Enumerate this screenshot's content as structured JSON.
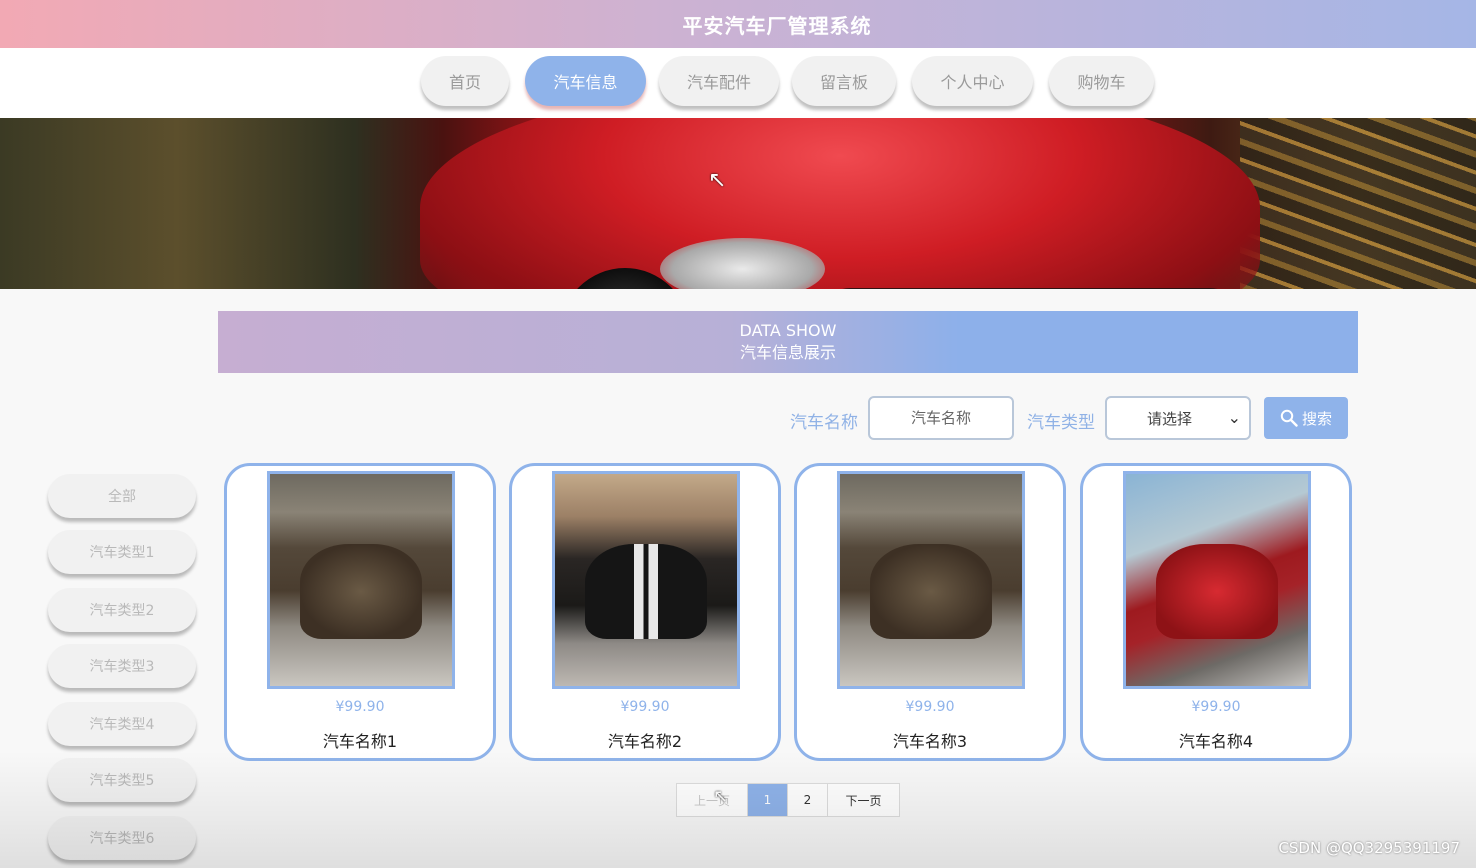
{
  "app": {
    "title": "平安汽车厂管理系统"
  },
  "nav": {
    "items": [
      {
        "label": "首页"
      },
      {
        "label": "汽车信息"
      },
      {
        "label": "汽车配件"
      },
      {
        "label": "留言板"
      },
      {
        "label": "个人中心"
      },
      {
        "label": "购物车"
      }
    ],
    "active": "汽车信息"
  },
  "section": {
    "title_en": "DATA SHOW",
    "title_cn": "汽车信息展示"
  },
  "search": {
    "name_label": "汽车名称",
    "name_placeholder": "汽车名称",
    "type_label": "汽车类型",
    "type_selected": "请选择",
    "button_label": "搜索"
  },
  "sidebar": {
    "items": [
      {
        "label": "全部"
      },
      {
        "label": "汽车类型1"
      },
      {
        "label": "汽车类型2"
      },
      {
        "label": "汽车类型3"
      },
      {
        "label": "汽车类型4"
      },
      {
        "label": "汽车类型5"
      },
      {
        "label": "汽车类型6"
      }
    ]
  },
  "products": [
    {
      "price": "¥99.90",
      "name": "汽车名称1"
    },
    {
      "price": "¥99.90",
      "name": "汽车名称2"
    },
    {
      "price": "¥99.90",
      "name": "汽车名称3"
    },
    {
      "price": "¥99.90",
      "name": "汽车名称4"
    }
  ],
  "pagination": {
    "prev": "上一页",
    "pages": [
      "1",
      "2"
    ],
    "current": "1",
    "next": "下一页"
  },
  "watermark": "CSDN @QQ3295391197",
  "colors": {
    "accent": "#8fb3ea",
    "header_start": "#f2a9b4",
    "header_end": "#a5b6e6"
  }
}
